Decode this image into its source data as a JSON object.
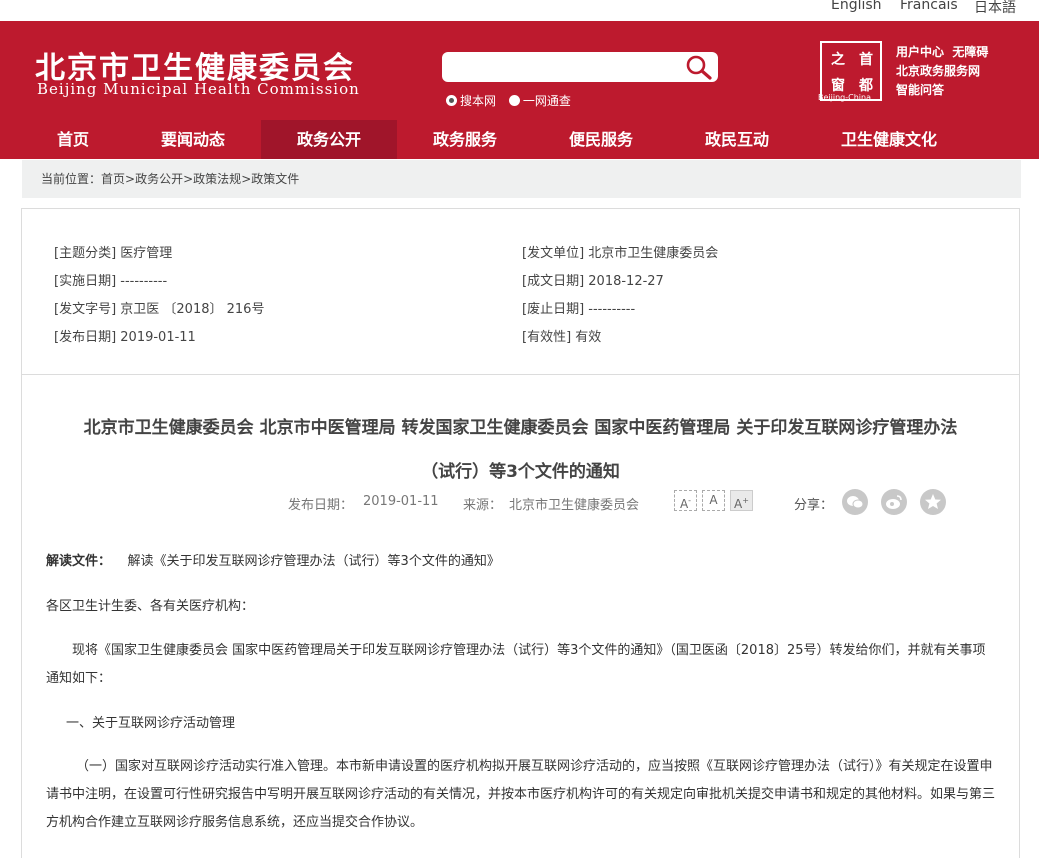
{
  "lang": {
    "english": "English",
    "francais": "Francais",
    "japanese": "日本語"
  },
  "header": {
    "logo_cn": "北京市卫生健康委员会",
    "logo_en": "Beijing Municipal Health Commission",
    "search": {
      "placeholder": "",
      "option_site": "搜本网",
      "option_all": "一网通查"
    },
    "seal": {
      "c1": "之",
      "c2": "首",
      "c3": "窗",
      "c4": "都",
      "sub": "Beijing-China"
    },
    "links": {
      "user_center": "用户中心",
      "accessible": "无障碍",
      "gov_service": "北京政务服务网",
      "smart_qa": "智能问答"
    }
  },
  "nav": [
    "首页",
    "要闻动态",
    "政务公开",
    "政务服务",
    "便民服务",
    "政民互动",
    "卫生健康文化"
  ],
  "breadcrumb": {
    "label": "当前位置：",
    "home": "首页",
    "sep": ">",
    "c1": "政务公开",
    "c2": "政策法规",
    "c3": "政策文件"
  },
  "info": {
    "topic": "[主题分类] 医疗管理",
    "issuer": "[发文单位] 北京市卫生健康委员会",
    "effective": "[实施日期] ----------",
    "created": "[成文日期] 2018-12-27",
    "doc_no": "[发文字号] 京卫医 〔2018〕 216号",
    "abolished": "[废止日期] ----------",
    "published": "[发布日期] 2019-01-11",
    "validity": "[有效性] 有效"
  },
  "doc": {
    "title_line1": "北京市卫生健康委员会 北京市中医管理局 转发国家卫生健康委员会 国家中医药管理局 关于印发互联网诊疗管理办法",
    "title_line2": "（试行）等3个文件的通知",
    "date_label": "发布日期：",
    "date": "2019-01-11",
    "source_label": "来源：",
    "source": "北京市卫生健康委员会",
    "font_small": "A",
    "font_mid": "A",
    "font_large": "A",
    "share_label": "分享："
  },
  "body": {
    "interpret_label": "解读文件：",
    "interpret_link": "解读《关于印发互联网诊疗管理办法（试行）等3个文件的通知》",
    "salutation": "各区卫生计生委、各有关医疗机构：",
    "para1_line1": "现将《国家卫生健康委员会 国家中医药管理局关于印发互联网诊疗管理办法（试行）等3个文件的通知》（国卫医函〔2018〕25号）转发给你们，并就有关事项",
    "para1_line2": "通知如下：",
    "section1": "一、关于互联网诊疗活动管理",
    "para2_line1": "（一）国家对互联网诊疗活动实行准入管理。本市新申请设置的医疗机构拟开展互联网诊疗活动的，应当按照《互联网诊疗管理办法（试行）》有关规定在设置申",
    "para2_line2": "请书中注明，在设置可行性研究报告中写明开展互联网诊疗活动的有关情况，并按本市医疗机构许可的有关规定向审批机关提交申请书和规定的其他材料。如果与第三",
    "para2_line3": "方机构合作建立互联网诊疗服务信息系统，还应当提交合作协议。"
  },
  "colors": {
    "brand_red": "#bd1a2e",
    "nav_active": "#a0152a",
    "breadcrumb_bg": "#eff0f0"
  }
}
